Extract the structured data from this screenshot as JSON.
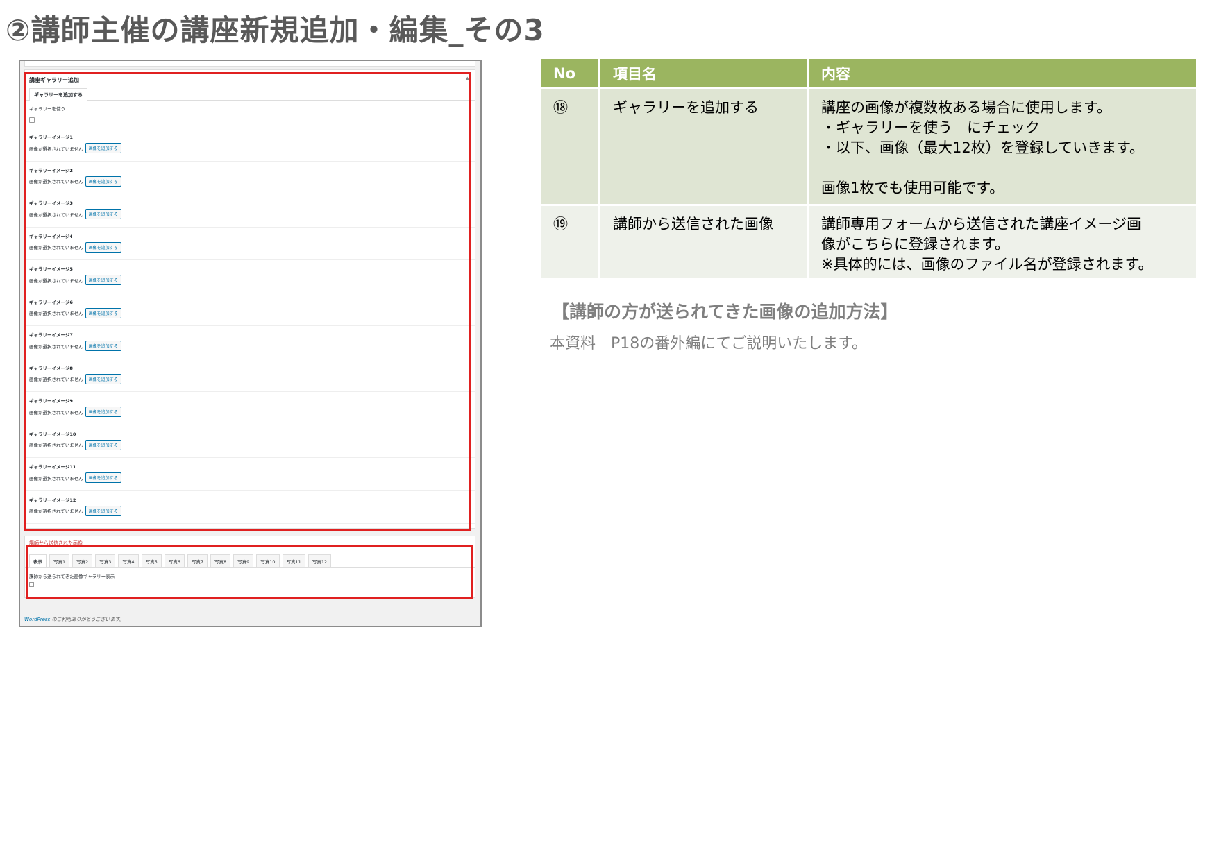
{
  "title": "②講師主催の講座新規追加・編集_その3",
  "screenshot": {
    "gallery_panel_title": "講座ギャラリー追加",
    "gallery_tab": "ギャラリーを追加する",
    "use_gallery_label": "ギャラリーを使う",
    "image_rows": [
      {
        "label": "ギャラリーイメージ1",
        "status": "画像が選択されていません",
        "button": "画像を追加する"
      },
      {
        "label": "ギャラリーイメージ2",
        "status": "画像が選択されていません",
        "button": "画像を追加する"
      },
      {
        "label": "ギャラリーイメージ3",
        "status": "画像が選択されていません",
        "button": "画像を追加する"
      },
      {
        "label": "ギャラリーイメージ4",
        "status": "画像が選択されていません",
        "button": "画像を追加する"
      },
      {
        "label": "ギャラリーイメージ5",
        "status": "画像が選択されていません",
        "button": "画像を追加する"
      },
      {
        "label": "ギャラリーイメージ6",
        "status": "画像が選択されていません",
        "button": "画像を追加する"
      },
      {
        "label": "ギャラリーイメージ7",
        "status": "画像が選択されていません",
        "button": "画像を追加する"
      },
      {
        "label": "ギャラリーイメージ8",
        "status": "画像が選択されていません",
        "button": "画像を追加する"
      },
      {
        "label": "ギャラリーイメージ9",
        "status": "画像が選択されていません",
        "button": "画像を追加する"
      },
      {
        "label": "ギャラリーイメージ10",
        "status": "画像が選択されていません",
        "button": "画像を追加する"
      },
      {
        "label": "ギャラリーイメージ11",
        "status": "画像が選択されていません",
        "button": "画像を追加する"
      },
      {
        "label": "ギャラリーイメージ12",
        "status": "画像が選択されていません",
        "button": "画像を追加する"
      }
    ],
    "sent_panel_title": "講師から送信された画像",
    "sent_tabs": [
      "表示",
      "写真1",
      "写真2",
      "写真3",
      "写真4",
      "写真5",
      "写真6",
      "写真7",
      "写真8",
      "写真9",
      "写真10",
      "写真11",
      "写真12"
    ],
    "sent_display_label": "講師から送られてきた画像ギャラリー表示",
    "footer_link": "WordPress",
    "footer_text": " のご利用ありがとうございます。"
  },
  "table": {
    "headers": {
      "no": "No",
      "item": "項目名",
      "content": "内容"
    },
    "rows": [
      {
        "no": "⑱",
        "item": "ギャラリーを追加する",
        "lines": [
          "講座の画像が複数枚ある場合に使用します。",
          "・ギャラリーを使う　にチェック",
          "・以下、画像（最大12枚）を登録していきます。",
          "",
          "画像1枚でも使用可能です。"
        ]
      },
      {
        "no": "⑲",
        "item": "講師から送信された画像",
        "lines": [
          "講師専用フォームから送信された講座イメージ画",
          "像がこちらに登録されます。",
          "※具体的には、画像のファイル名が登録されます。"
        ]
      }
    ]
  },
  "howto": {
    "heading": "【講師の方が送られてきた画像の追加方法】",
    "text": "本資料　P18の番外編にてご説明いたします。"
  },
  "colors": {
    "header_green": "#9bb560",
    "row1_bg": "#dfe5d3",
    "row2_bg": "#eef1ea",
    "highlight_red": "#e02020"
  }
}
